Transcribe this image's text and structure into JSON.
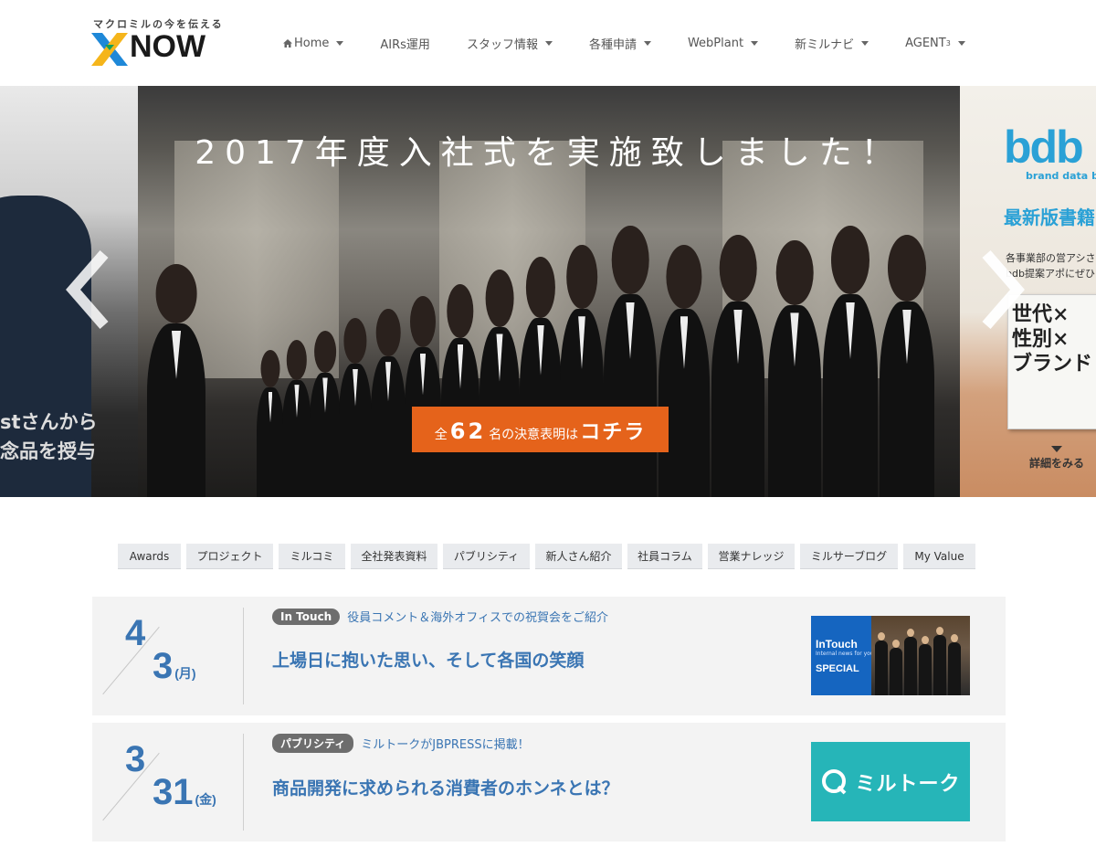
{
  "header": {
    "logo_tagline": "マクロミルの今を伝える",
    "logo_text": "NOW",
    "nav": [
      {
        "label": "Home"
      },
      {
        "label": "AIRs運用"
      },
      {
        "label": "スタッフ情報"
      },
      {
        "label": "各種申請"
      },
      {
        "label": "WebPlant"
      },
      {
        "label": "新ミルナビ"
      },
      {
        "label": "AGENT",
        "sup": "3"
      }
    ]
  },
  "slider": {
    "left_text_1": "stさんから",
    "left_text_2": "念品を授与",
    "main_title": "2017年度入社式を実施致しました！",
    "cta": {
      "prefix": "全",
      "number": "62",
      "middle": "名の決意表明は",
      "emphasis": "コチラ"
    },
    "right": {
      "logo": "bdb",
      "logo_sub": "brand data bank",
      "headline": "最新版書籍",
      "desc_1": "各事業部の営アシさん",
      "desc_2": "bdb提案アポにぜひ",
      "book_title": "世代×\n性別×\nブランド",
      "more_label": "詳細をみる"
    },
    "colors": {
      "cta": "#e5631b",
      "bdb": "#2aa1d6"
    }
  },
  "categories": [
    "Awards",
    "プロジェクト",
    "ミルコミ",
    "全社発表資料",
    "パブリシティ",
    "新人さん紹介",
    "社員コラム",
    "営業ナレッジ",
    "ミルサーブログ",
    "My Value"
  ],
  "news": [
    {
      "month": "4",
      "day": "3",
      "weekday": "(月)",
      "tag": "In Touch",
      "subtitle": "役員コメント＆海外オフィスでの祝賀会をご紹介",
      "title": "上場日に抱いた思い、そして各国の笑顔",
      "thumb": {
        "line1": "InTouch",
        "line2": "Internal news for you",
        "line3": "SPECIAL"
      }
    },
    {
      "month": "3",
      "day": "31",
      "weekday": "(金)",
      "tag": "パブリシティ",
      "subtitle": "ミルトークがJBPRESSに掲載！",
      "title": "商品開発に求められる消費者のホンネとは？",
      "thumb": {
        "label": "ミルトーク"
      }
    }
  ],
  "colors": {
    "link_blue": "#3a75b3",
    "tag_gray": "#6d6d6d",
    "miltalk": "#26b5b8"
  }
}
